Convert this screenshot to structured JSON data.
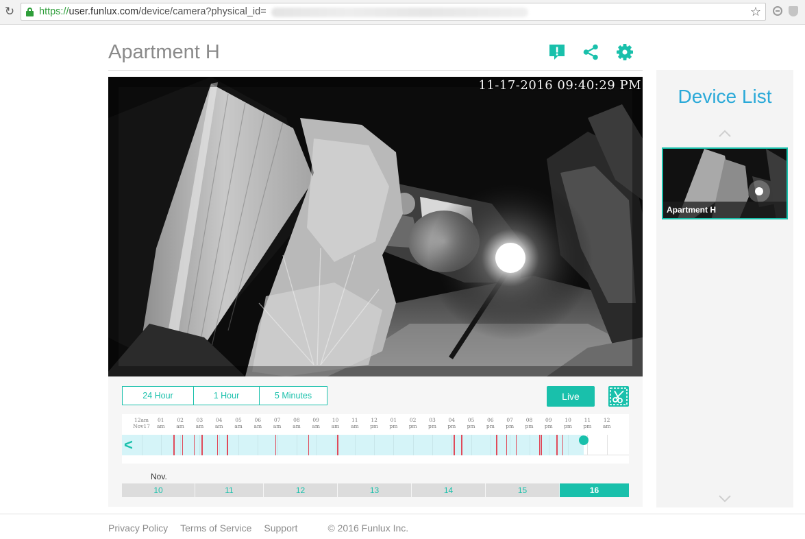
{
  "browser": {
    "url_scheme": "https://",
    "url_host": "user.funlux.com",
    "url_path": "/device/camera?physical_id="
  },
  "page": {
    "title": "Apartment H",
    "icons": [
      "alert-icon",
      "share-icon",
      "settings-gear-icon"
    ]
  },
  "video": {
    "timestamp": "11-17-2016 09:40:29 PM"
  },
  "controls": {
    "ranges": [
      {
        "label": "24 Hour",
        "active": true
      },
      {
        "label": "1 Hour",
        "active": false
      },
      {
        "label": "5 Minutes",
        "active": false
      }
    ],
    "live_label": "Live"
  },
  "timeline": {
    "ticks": [
      [
        "12am",
        "Nov17"
      ],
      [
        "01",
        "am"
      ],
      [
        "02",
        "am"
      ],
      [
        "03",
        "am"
      ],
      [
        "04",
        "am"
      ],
      [
        "05",
        "am"
      ],
      [
        "06",
        "am"
      ],
      [
        "07",
        "am"
      ],
      [
        "08",
        "am"
      ],
      [
        "09",
        "am"
      ],
      [
        "10",
        "am"
      ],
      [
        "11",
        "am"
      ],
      [
        "12",
        "pm"
      ],
      [
        "01",
        "pm"
      ],
      [
        "02",
        "pm"
      ],
      [
        "03",
        "pm"
      ],
      [
        "04",
        "pm"
      ],
      [
        "05",
        "pm"
      ],
      [
        "06",
        "pm"
      ],
      [
        "07",
        "pm"
      ],
      [
        "08",
        "pm"
      ],
      [
        "09",
        "pm"
      ],
      [
        "10",
        "pm"
      ],
      [
        "11",
        "pm"
      ],
      [
        "12",
        "am"
      ]
    ],
    "recorded_until_hour": 22.8,
    "playhead_hour": 22.8,
    "events_hours": [
      1.65,
      2.1,
      2.7,
      3.1,
      3.9,
      4.4,
      6.9,
      8.6,
      10.1,
      16.1,
      16.5,
      18.3,
      18.8,
      19.3,
      20.5,
      20.6,
      21.4,
      21.7
    ],
    "accent_color": "#19c0ab"
  },
  "calendar": {
    "month": "Nov.",
    "days": [
      {
        "label": "10",
        "active": false
      },
      {
        "label": "11",
        "active": false
      },
      {
        "label": "12",
        "active": false
      },
      {
        "label": "13",
        "active": false
      },
      {
        "label": "14",
        "active": false
      },
      {
        "label": "15",
        "active": false
      },
      {
        "label": "16",
        "active": true
      }
    ]
  },
  "sidebar": {
    "title": "Device List",
    "devices": [
      {
        "name": "Apartment H",
        "selected": true
      }
    ]
  },
  "footer": {
    "links": [
      "Privacy Policy",
      "Terms of Service",
      "Support"
    ],
    "copyright": "© 2016 Funlux Inc."
  }
}
